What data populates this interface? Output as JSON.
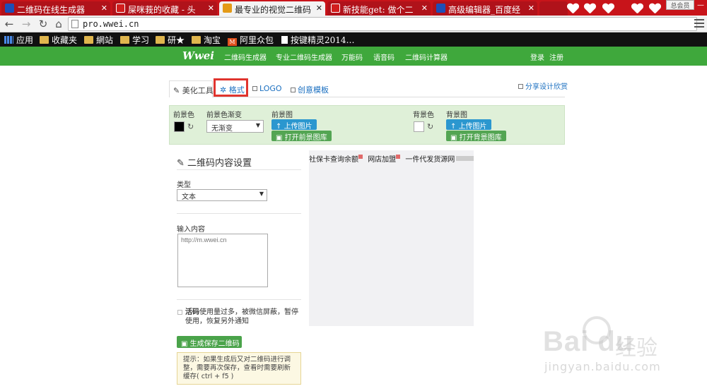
{
  "browser": {
    "tabs": [
      {
        "title": "二维码在线生成器",
        "icon": "baidu-paw-icon",
        "active": false
      },
      {
        "title": "屎咪莪的收藏 - 头",
        "icon": "toutiao-icon",
        "active": false
      },
      {
        "title": "最专业的视觉二维码",
        "icon": "wwei-icon",
        "active": true
      },
      {
        "title": "新技能get: 做个二",
        "icon": "toutiao-icon",
        "active": false
      },
      {
        "title": "高级编辑器_百度经",
        "icon": "baidu-paw-icon",
        "active": false
      }
    ],
    "profile_badge": "总会员",
    "url": "pro.wwei.cn",
    "bookmarks": [
      {
        "label": "应用",
        "icon": "apps-grid-icon"
      },
      {
        "label": "收藏夹",
        "icon": "folder-icon"
      },
      {
        "label": "網站",
        "icon": "folder-icon"
      },
      {
        "label": "学习",
        "icon": "folder-icon"
      },
      {
        "label": "研★",
        "icon": "folder-icon"
      },
      {
        "label": "淘宝",
        "icon": "folder-icon"
      },
      {
        "label": "阿里众包",
        "icon": "alibaba-icon"
      },
      {
        "label": "按键精灵2014…",
        "icon": "page-icon"
      }
    ]
  },
  "site": {
    "logo": "Wwei",
    "nav": [
      "二维码生成器",
      "专业二维码生成器",
      "万能码",
      "语音码",
      "二维码计算器"
    ],
    "login": "登录",
    "register": "注册"
  },
  "tools": {
    "tabs": {
      "beautify": "美化工具",
      "format": "格式",
      "logo": "LOGO",
      "template": "创意模板"
    },
    "share": "分享设计欣赏"
  },
  "colors": {
    "fg_label": "前景色",
    "fg_gradient_label": "前景色渐变",
    "fg_gradient_value": "无渐变",
    "fg_image_label": "前景图",
    "upload_image": "上传图片",
    "open_fg_gallery": "打开前景图库",
    "bg_label": "背景色",
    "bg_image_label": "背景图",
    "open_bg_gallery": "打开背景图库",
    "fg_swatch": "#000000",
    "bg_swatch": "#ffffff",
    "brand_green": "#3fa83c"
  },
  "settings": {
    "title": "二维码内容设置",
    "type_label": "类型",
    "type_value": "文本",
    "content_label": "输入内容",
    "content_placeholder": "http://m.wwei.cn",
    "warn_bold": "活码",
    "warn_rest": "使用量过多，被微信屏蔽，暂停使用，恢复另外通知",
    "generate": "生成保存二维码",
    "tip": "提示：如果生成后又对二维码进行调整，需要再次保存，查看时需要刷新缓存( ctrl + f5 )"
  },
  "preview": {
    "ads": [
      "社保卡查询余额",
      "网店加盟",
      "一件代发货源网"
    ]
  },
  "watermark": {
    "brand": "Bai du",
    "brand_cn": "经验",
    "url": "jingyan.baidu.com"
  }
}
